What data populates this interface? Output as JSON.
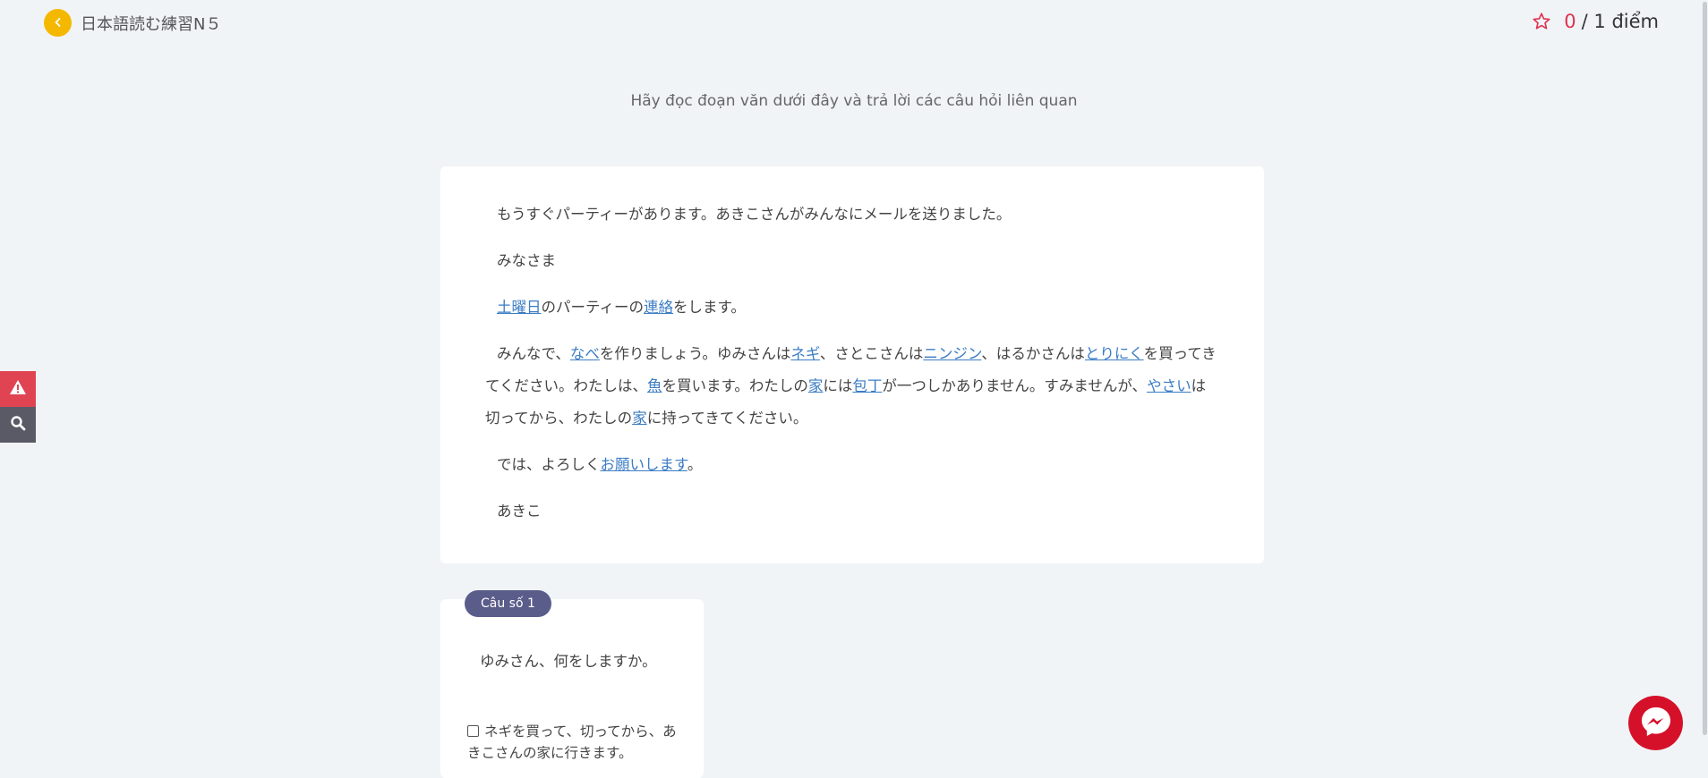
{
  "header": {
    "title": "日本語読む練習N５",
    "score_current": "0",
    "score_rest": "/ 1 điểm"
  },
  "instruction": "Hãy đọc đoạn văn dưới đây và trả lời các câu hỏi liên quan",
  "passage": {
    "p1": "もうすぐパーティーがあります。あきこさんがみんなにメールを送りました。",
    "p2": "みなさま",
    "p3": [
      {
        "text": "土曜日",
        "link": true
      },
      {
        "text": "のパーティーの",
        "link": false
      },
      {
        "text": "連絡",
        "link": true
      },
      {
        "text": "をします。",
        "link": false
      }
    ],
    "p4": [
      {
        "text": "みんなで、",
        "link": false
      },
      {
        "text": "なべ",
        "link": true
      },
      {
        "text": "を作りましょう。ゆみさんは",
        "link": false
      },
      {
        "text": "ネギ",
        "link": true
      },
      {
        "text": "、さとこさんは",
        "link": false
      },
      {
        "text": "ニンジン",
        "link": true
      },
      {
        "text": "、はるかさんは",
        "link": false
      },
      {
        "text": "とりにく",
        "link": true
      },
      {
        "text": "を買ってきてください。わたしは、",
        "link": false
      },
      {
        "text": "魚",
        "link": true
      },
      {
        "text": "を買います。わたしの",
        "link": false
      },
      {
        "text": "家",
        "link": true
      },
      {
        "text": "には",
        "link": false
      },
      {
        "text": "包丁",
        "link": true
      },
      {
        "text": "が一つしかありません。すみませんが、",
        "link": false
      },
      {
        "text": "やさい",
        "link": true
      },
      {
        "text": "は切ってから、わたしの",
        "link": false
      },
      {
        "text": "家",
        "link": true
      },
      {
        "text": "に持ってきてください。",
        "link": false
      }
    ],
    "p5": [
      {
        "text": "では、よろしく",
        "link": false
      },
      {
        "text": "お願いします",
        "link": true
      },
      {
        "text": "。",
        "link": false
      }
    ],
    "p6": "あきこ"
  },
  "question": {
    "badge": "Câu số 1",
    "text": "ゆみさん、何をしますか。",
    "option_1": "ネギを買って、切ってから、あきこさんの家に行きます。"
  },
  "colors": {
    "accent_yellow": "#f5b800",
    "score_red": "#e0324f",
    "link_blue": "#3b7cc4",
    "badge": "#5a5c8a",
    "messenger": "#d5112a"
  },
  "icons": [
    "chevron-left-icon",
    "star-icon",
    "alert-icon",
    "search-icon",
    "messenger-icon"
  ]
}
